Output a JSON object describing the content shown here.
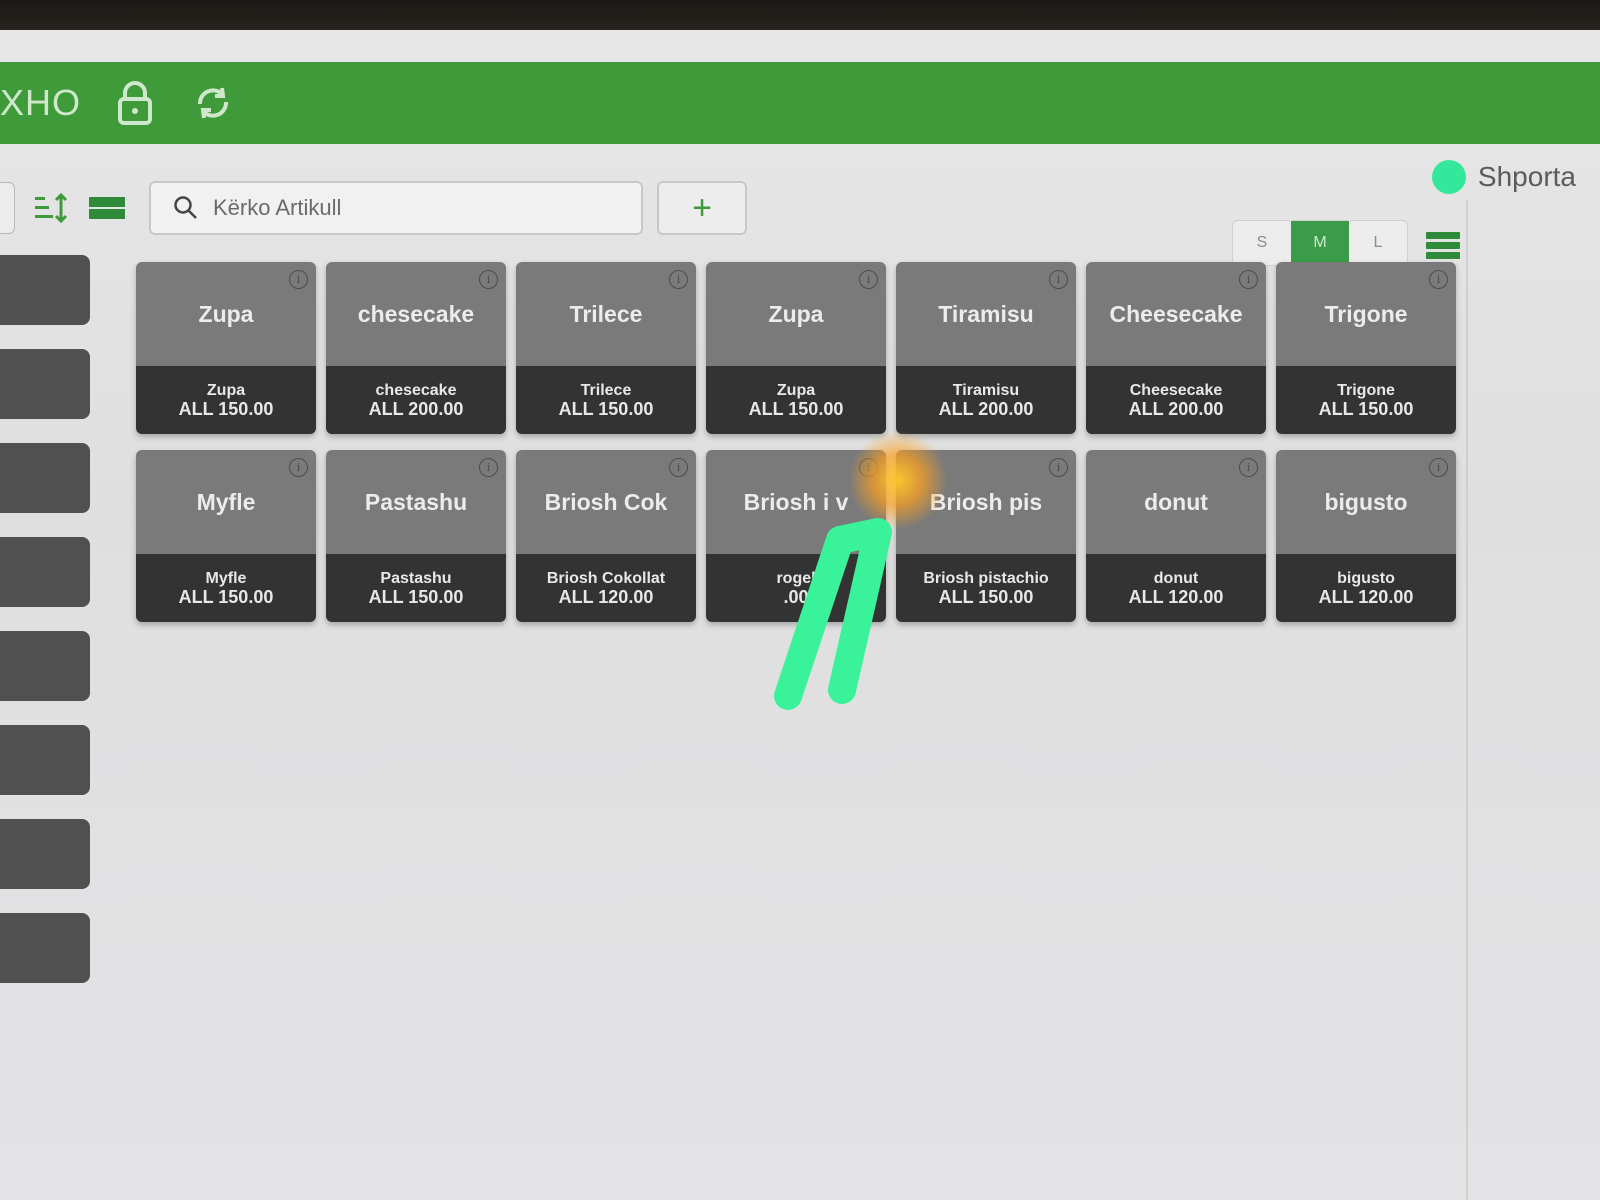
{
  "app": {
    "name": "XHO"
  },
  "cart": {
    "label": "Shporta"
  },
  "search": {
    "placeholder": "Kërko Artikull"
  },
  "toolbar": {
    "add_label": "+"
  },
  "sizes": [
    {
      "label": "S",
      "active": false
    },
    {
      "label": "M",
      "active": true
    },
    {
      "label": "L",
      "active": false
    }
  ],
  "products": [
    {
      "title": "Zupa",
      "name": "Zupa",
      "price": "ALL 150.00"
    },
    {
      "title": "chesecake",
      "name": "chesecake",
      "price": "ALL 200.00"
    },
    {
      "title": "Trilece",
      "name": "Trilece",
      "price": "ALL 150.00"
    },
    {
      "title": "Zupa",
      "name": "Zupa",
      "price": "ALL 150.00"
    },
    {
      "title": "Tiramisu",
      "name": "Tiramisu",
      "price": "ALL 200.00"
    },
    {
      "title": "Cheesecake",
      "name": "Cheesecake",
      "price": "ALL 200.00"
    },
    {
      "title": "Trigone",
      "name": "Trigone",
      "price": "ALL 150.00"
    },
    {
      "title": "Myfle",
      "name": "Myfle",
      "price": "ALL 150.00"
    },
    {
      "title": "Pastashu",
      "name": "Pastashu",
      "price": "ALL 150.00"
    },
    {
      "title": "Briosh Cok",
      "name": "Briosh Cokollat",
      "price": "ALL 120.00"
    },
    {
      "title": "Briosh i v",
      "name": "rogel",
      "price": ".00"
    },
    {
      "title": "Briosh pis",
      "name": "Briosh pistachio",
      "price": "ALL 150.00"
    },
    {
      "title": "donut",
      "name": "donut",
      "price": "ALL 120.00"
    },
    {
      "title": "bigusto",
      "name": "bigusto",
      "price": "ALL 120.00"
    }
  ],
  "colors": {
    "brand_green": "#3f9a3a",
    "cart_dot": "#33e89a",
    "tile_top": "#7a7a7a",
    "tile_bottom": "#333333"
  },
  "icons": {
    "lock": "lock-icon",
    "sync": "sync-icon",
    "sort": "sort-icon",
    "layout": "layout-icon",
    "search": "search-icon",
    "info": "info-icon",
    "list_view": "list-view-icon"
  }
}
